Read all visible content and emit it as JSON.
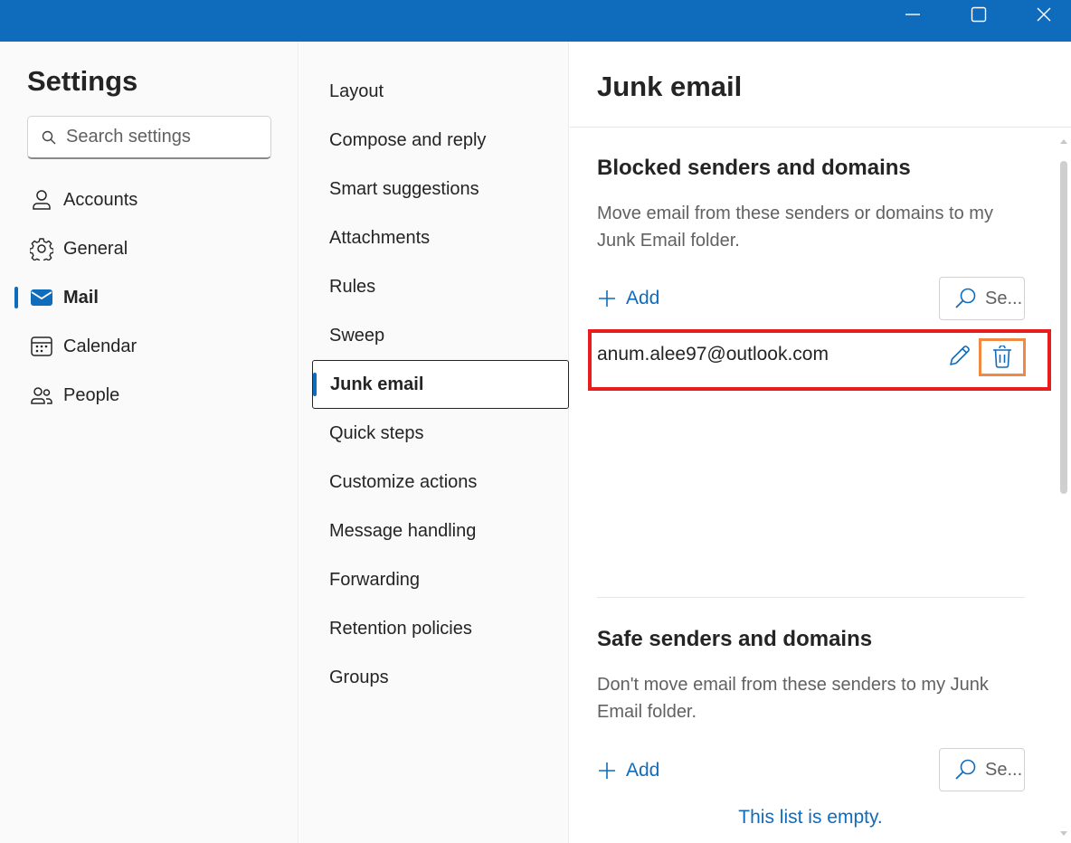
{
  "window": {
    "minimize_icon": "minimize-icon",
    "maximize_icon": "maximize-icon",
    "close_icon": "close-icon",
    "accent_color": "#0f6cbd"
  },
  "leftnav": {
    "title": "Settings",
    "search": {
      "placeholder": "Search settings",
      "value": ""
    },
    "items": [
      {
        "label": "Accounts",
        "icon": "person-icon"
      },
      {
        "label": "General",
        "icon": "gear-icon"
      },
      {
        "label": "Mail",
        "icon": "mail-icon",
        "active": true
      },
      {
        "label": "Calendar",
        "icon": "calendar-icon"
      },
      {
        "label": "People",
        "icon": "people-icon"
      }
    ]
  },
  "midnav": {
    "items": [
      {
        "label": "Layout"
      },
      {
        "label": "Compose and reply"
      },
      {
        "label": "Smart suggestions"
      },
      {
        "label": "Attachments"
      },
      {
        "label": "Rules"
      },
      {
        "label": "Sweep"
      },
      {
        "label": "Junk email",
        "active": true
      },
      {
        "label": "Quick steps"
      },
      {
        "label": "Customize actions"
      },
      {
        "label": "Message handling"
      },
      {
        "label": "Forwarding"
      },
      {
        "label": "Retention policies"
      },
      {
        "label": "Groups"
      }
    ]
  },
  "pane": {
    "title": "Junk email",
    "blocked": {
      "title": "Blocked senders and domains",
      "description": "Move email from these senders or domains to my Junk Email folder.",
      "add_label": "Add",
      "search_label": "Se...",
      "entries": [
        {
          "email": "anum.alee97@outlook.com"
        }
      ]
    },
    "safe": {
      "title": "Safe senders and domains",
      "description": "Don't move email from these senders to my Junk Email folder.",
      "add_label": "Add",
      "search_label": "Se...",
      "empty_text": "This list is empty."
    }
  },
  "highlight_colors": {
    "row_outline": "#e81e1e",
    "delete_outline": "#f08a43"
  }
}
